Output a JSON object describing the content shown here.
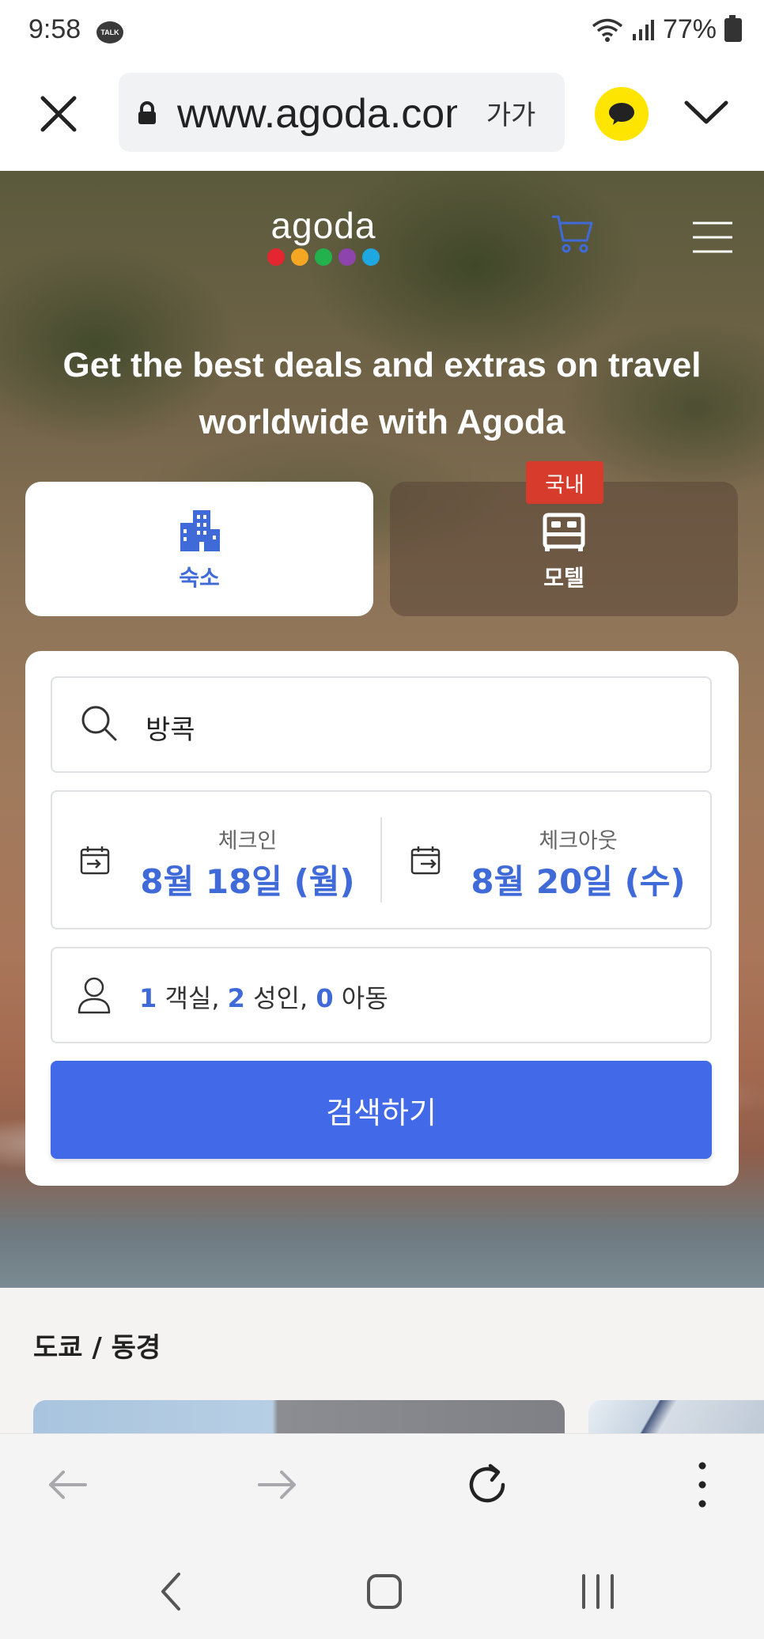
{
  "status_bar": {
    "time": "9:58",
    "talk_badge": "TALK",
    "battery": "77%"
  },
  "browser": {
    "url": "www.agoda.com",
    "font_size_label": "가가"
  },
  "hero": {
    "logo": "agoda",
    "logo_dot_colors": [
      "#e3262f",
      "#f5a623",
      "#23b14d",
      "#8e44ad",
      "#1ea7e1"
    ],
    "title_line1": "Get the best deals and extras on travel",
    "title_line2": "worldwide with Agoda",
    "tabs": [
      {
        "label": "숙소",
        "icon": "hotel-building-icon",
        "selected": true
      },
      {
        "label": "모텔",
        "icon": "bed-icon",
        "selected": false,
        "badge": "국내"
      }
    ]
  },
  "search": {
    "destination": "방콕",
    "checkin_label": "체크인",
    "checkin_value": "8월 18일 (월)",
    "checkout_label": "체크아웃",
    "checkout_value": "8월 20일 (수)",
    "rooms": "1",
    "rooms_label": " 객실, ",
    "adults": "2",
    "adults_label": " 성인, ",
    "children": "0",
    "children_label": " 아동",
    "button_label": "검색하기"
  },
  "section": {
    "title": "도쿄 / 동경"
  },
  "colors": {
    "accent": "#4169e8",
    "text_accent": "#3f6ad8",
    "badge_red": "#d63b2b",
    "kakao_yellow": "#fee500"
  }
}
